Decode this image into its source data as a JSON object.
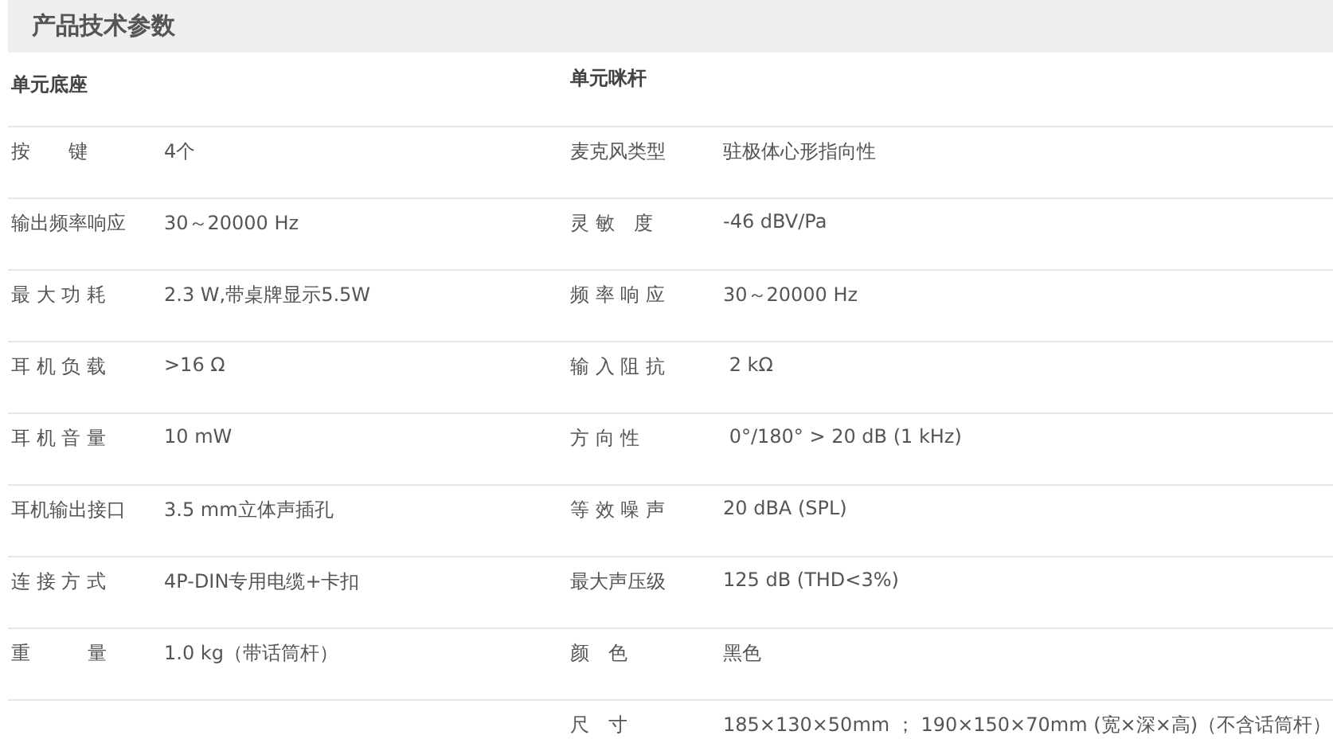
{
  "title": "产品技术参数",
  "sections": [
    {
      "heading": "单元底座",
      "rows": [
        {
          "label": "按　　键",
          "value": "4个"
        },
        {
          "label": "输出频率响应",
          "value": "30～20000 Hz"
        },
        {
          "label": "最 大 功 耗",
          "value": "2.3 W,带桌牌显示5.5W"
        },
        {
          "label": "耳 机 负 载",
          "value": ">16 Ω"
        },
        {
          "label": "耳 机 音 量",
          "value": "10 mW"
        },
        {
          "label": "耳机输出接口",
          "value": "3.5 mm立体声插孔"
        },
        {
          "label": "连 接 方 式",
          "value": "4P-DIN专用电缆+卡扣"
        },
        {
          "label": "重　　　量",
          "value": "1.0 kg（带话筒杆）"
        }
      ]
    },
    {
      "heading": "单元咪杆",
      "rows": [
        {
          "label": "麦克风类型",
          "value": "驻极体心形指向性"
        },
        {
          "label": "灵 敏　度",
          "value": "-46 dBV/Pa"
        },
        {
          "label": "频 率 响 应",
          "value": "30～20000 Hz"
        },
        {
          "label": "输 入 阻 抗",
          "value": " 2 kΩ"
        },
        {
          "label": "方 向 性",
          "value": " 0°/180° > 20 dB (1 kHz)"
        },
        {
          "label": "等 效 噪 声",
          "value": "20 dBA (SPL)"
        },
        {
          "label": "最大声压级",
          "value": "125 dB (THD<3%)"
        },
        {
          "label": "颜　色",
          "value": "黑色"
        },
        {
          "label": "尺　寸",
          "value": "185×130×50mm ； 190×150×70mm (宽×深×高)（不含话筒杆）"
        }
      ]
    }
  ]
}
